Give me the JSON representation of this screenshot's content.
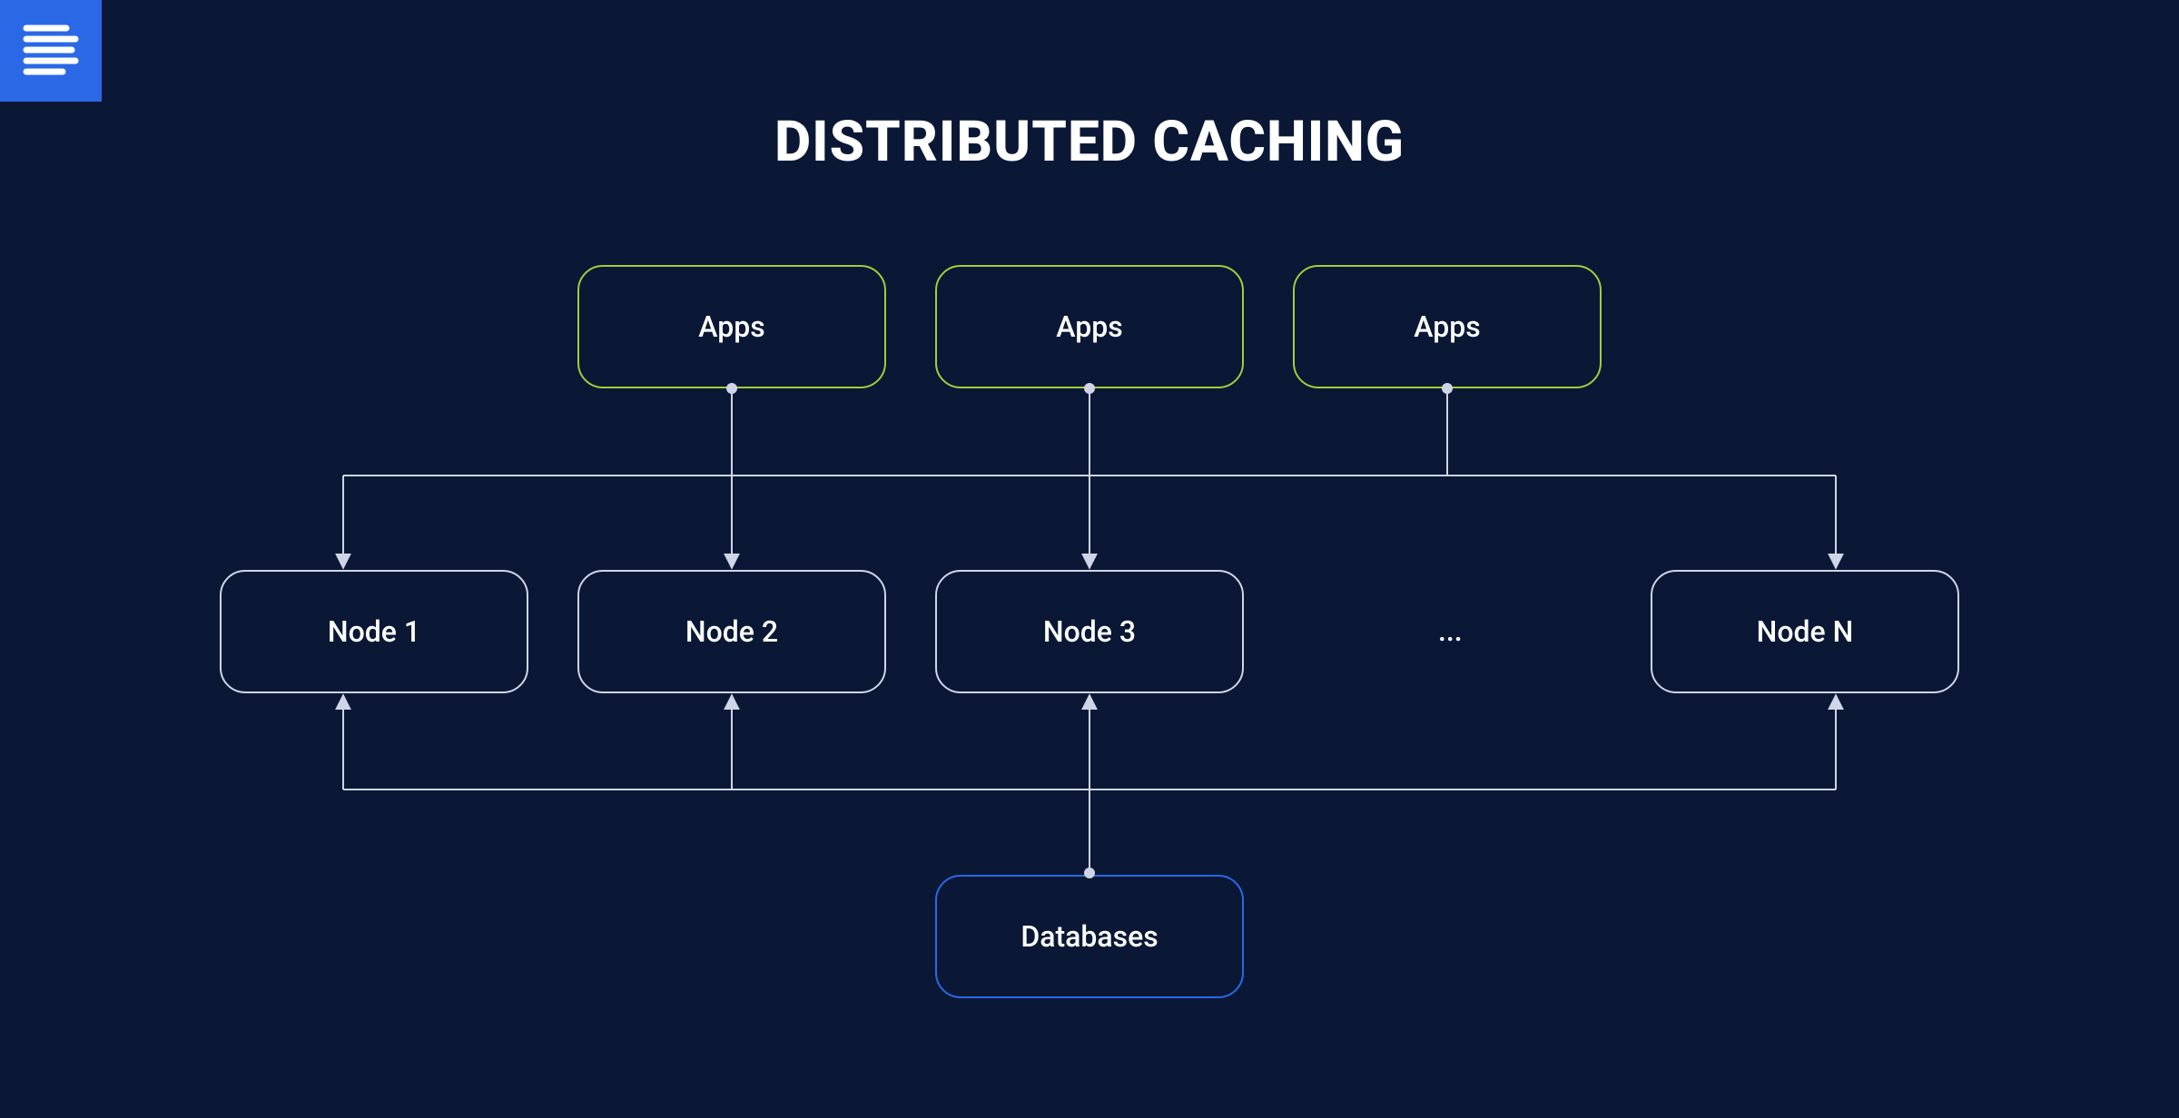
{
  "title": "DISTRIBUTED CACHING",
  "apps": {
    "a1": "Apps",
    "a2": "Apps",
    "a3": "Apps"
  },
  "nodes": {
    "n1": "Node 1",
    "n2": "Node 2",
    "n3": "Node 3",
    "ellipsis": "...",
    "nn": "Node N"
  },
  "db": {
    "label": "Databases"
  },
  "colors": {
    "bg": "#0a1836",
    "green": "#a4cc3c",
    "white": "#cfd5e6",
    "blue": "#2a68e6",
    "logo_bg": "#2a68e6"
  }
}
